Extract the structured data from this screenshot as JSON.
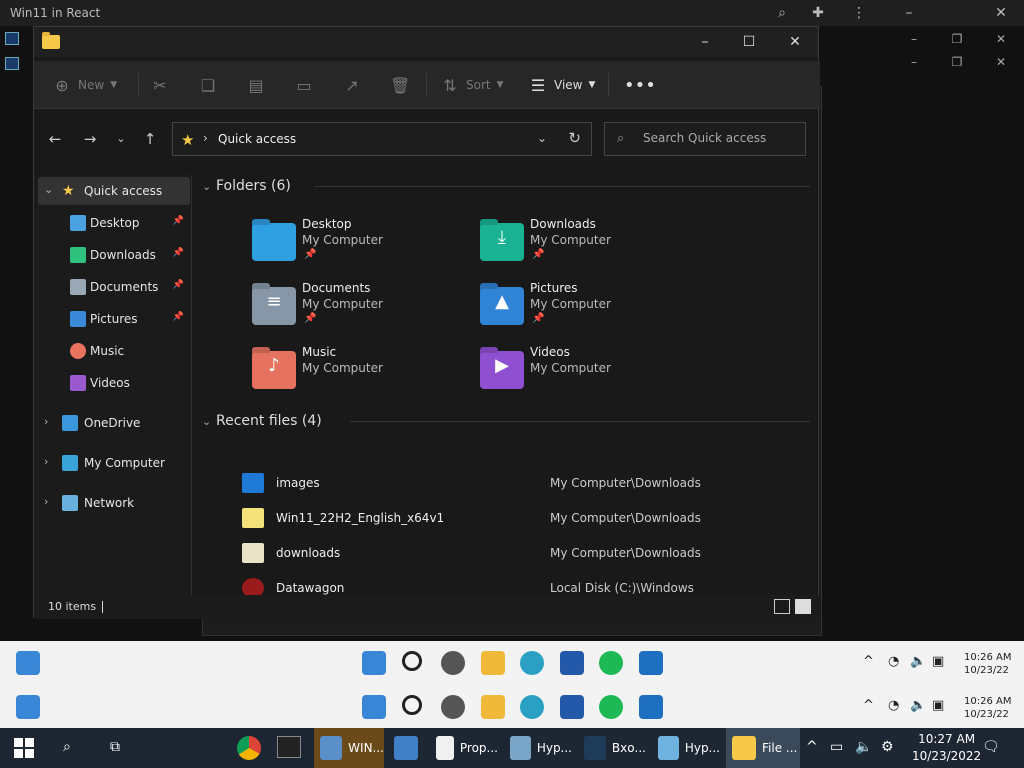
{
  "host": {
    "title": "Win11 in React"
  },
  "explorer": {
    "toolbar": {
      "new": "New",
      "sort": "Sort",
      "view": "View"
    },
    "address": {
      "path": "Quick access",
      "search_placeholder": "Search Quick access"
    },
    "sidebar": [
      {
        "label": "Quick access",
        "icon": "star-icon",
        "color": "#f7c948",
        "expand": "v",
        "selected": true
      },
      {
        "label": "Desktop",
        "icon": "desktop-icon",
        "color": "#4aa3df",
        "pinned": true
      },
      {
        "label": "Downloads",
        "icon": "download-icon",
        "color": "#2ec27e",
        "pinned": true
      },
      {
        "label": "Documents",
        "icon": "document-icon",
        "color": "#9aa7b5",
        "pinned": true
      },
      {
        "label": "Pictures",
        "icon": "picture-icon",
        "color": "#3b8ad9",
        "pinned": true
      },
      {
        "label": "Music",
        "icon": "music-icon",
        "color": "#e9735e"
      },
      {
        "label": "Videos",
        "icon": "video-icon",
        "color": "#9b59d0"
      },
      {
        "label": "OneDrive",
        "icon": "cloud-icon",
        "color": "#3a96dd",
        "expand": ">"
      },
      {
        "label": "My Computer",
        "icon": "computer-icon",
        "color": "#3aa3d8",
        "expand": ">"
      },
      {
        "label": "Network",
        "icon": "network-icon",
        "color": "#6ab0de",
        "expand": ">"
      }
    ],
    "folders_header": "Folders (6)",
    "folders": [
      {
        "name": "Desktop",
        "location": "My Computer",
        "pinned": true,
        "color": "#2e9fe0",
        "icon": "desktop-folder-icon",
        "glyph": ""
      },
      {
        "name": "Downloads",
        "location": "My Computer",
        "pinned": true,
        "color": "#19b394",
        "icon": "downloads-folder-icon",
        "glyph": "⤓"
      },
      {
        "name": "Documents",
        "location": "My Computer",
        "pinned": true,
        "color": "#8797a8",
        "icon": "documents-folder-icon",
        "glyph": "≡"
      },
      {
        "name": "Pictures",
        "location": "My Computer",
        "pinned": true,
        "color": "#2f84d6",
        "icon": "pictures-folder-icon",
        "glyph": "▲"
      },
      {
        "name": "Music",
        "location": "My Computer",
        "pinned": false,
        "color": "#e4725f",
        "icon": "music-folder-icon",
        "glyph": "♪"
      },
      {
        "name": "Videos",
        "location": "My Computer",
        "pinned": false,
        "color": "#8e4fd1",
        "icon": "videos-folder-icon",
        "glyph": "▶"
      }
    ],
    "recent_header": "Recent files (4)",
    "recent": [
      {
        "name": "images",
        "path": "My Computer\\Downloads",
        "color": "#1e7ad6",
        "icon": "image-file-icon"
      },
      {
        "name": "Win11_22H2_English_x64v1",
        "path": "My Computer\\Downloads",
        "color": "#f3e17a",
        "icon": "iso-file-icon"
      },
      {
        "name": "downloads",
        "path": "My Computer\\Downloads",
        "color": "#e9e2c4",
        "icon": "script-file-icon"
      },
      {
        "name": "Datawagon",
        "path": "Local Disk (C:)\\Windows",
        "color": "#9a1b1b",
        "icon": "app-file-icon"
      }
    ],
    "status": "10 items"
  },
  "inner_taskbar": {
    "time": "10:26 AM",
    "date": "10/23/22"
  },
  "taskbar": {
    "items": [
      {
        "label": "WIN...",
        "color": "#5b8fc9",
        "icon": "vmware-icon",
        "style": "orange"
      },
      {
        "label": "",
        "color": "#3f7fc6",
        "icon": "remote-icon",
        "style": ""
      },
      {
        "label": "Prop...",
        "color": "#f0f0f0",
        "icon": "properties-icon",
        "style": ""
      },
      {
        "label": "Hyp...",
        "color": "#7aa7c9",
        "icon": "hyperv-icon",
        "style": ""
      },
      {
        "label": "Вхо...",
        "color": "#1f3b5a",
        "icon": "steam-icon",
        "style": ""
      },
      {
        "label": "Hyp...",
        "color": "#6fb2e0",
        "icon": "hyperv2-icon",
        "style": ""
      },
      {
        "label": "File ...",
        "color": "#f7c948",
        "icon": "file-explorer-icon",
        "style": "active"
      }
    ],
    "time": "10:27 AM",
    "date": "10/23/2022"
  }
}
